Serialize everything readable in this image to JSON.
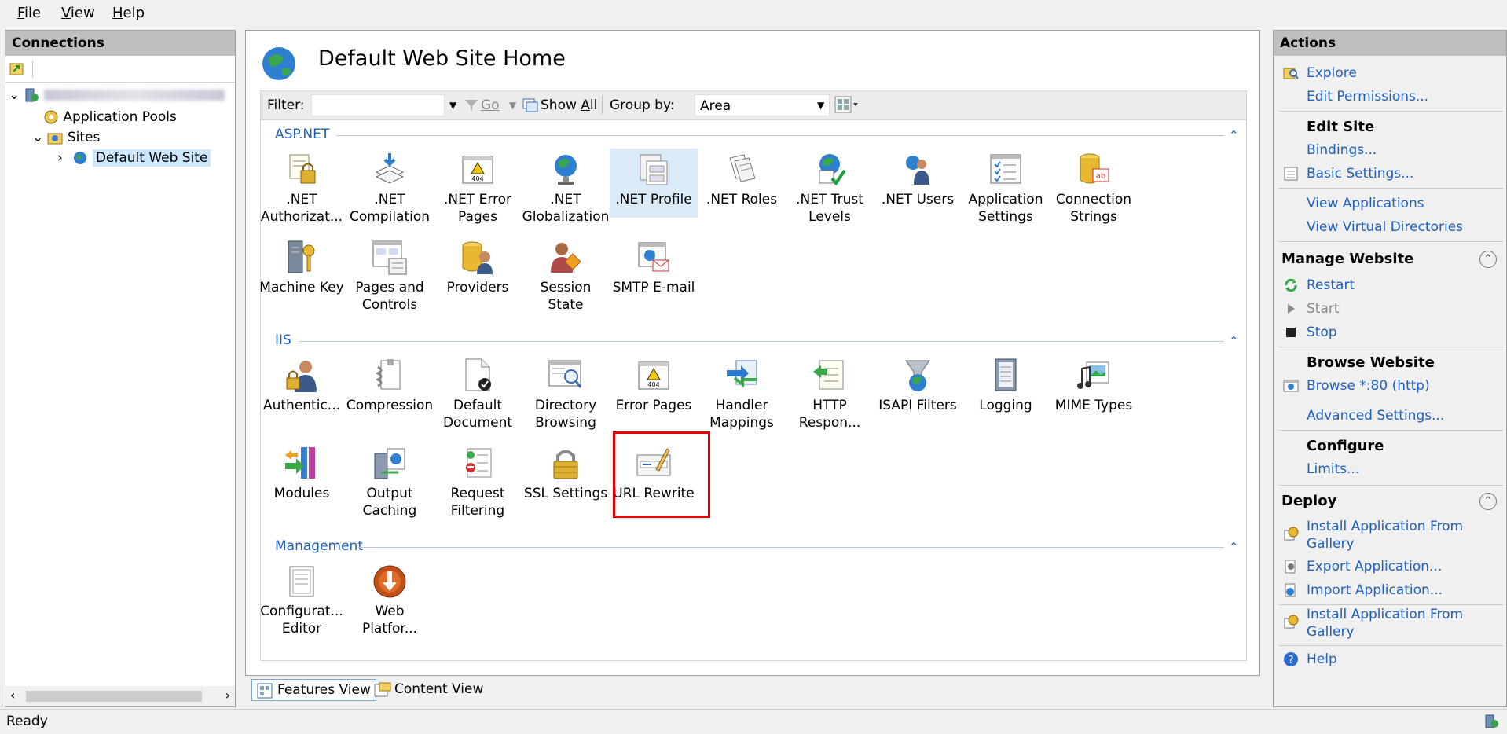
{
  "menu": {
    "file": {
      "accel": "F",
      "rest": "ile"
    },
    "view": {
      "accel": "V",
      "rest": "iew"
    },
    "help": {
      "accel": "H",
      "rest": "elp"
    }
  },
  "connections": {
    "title": "Connections",
    "tree": {
      "application_pools": "Application Pools",
      "sites": "Sites",
      "default_web_site": "Default Web Site"
    }
  },
  "center": {
    "title": "Default Web Site Home",
    "filter": {
      "label": "Filter:",
      "go": "Go",
      "show_all": {
        "pre": "Show ",
        "accel": "A",
        "rest": "ll"
      },
      "group_by_label": "Group by:",
      "group_by_value": "Area"
    },
    "groups": {
      "aspnet": {
        "title": "ASP.NET",
        "items": [
          {
            "line1": ".NET",
            "line2": "Authorizat..."
          },
          {
            "line1": ".NET",
            "line2": "Compilation"
          },
          {
            "line1": ".NET Error",
            "line2": "Pages"
          },
          {
            "line1": ".NET",
            "line2": "Globalization"
          },
          {
            "line1": ".NET Profile",
            "line2": ""
          },
          {
            "line1": ".NET Roles",
            "line2": ""
          },
          {
            "line1": ".NET Trust",
            "line2": "Levels"
          },
          {
            "line1": ".NET Users",
            "line2": ""
          },
          {
            "line1": "Application",
            "line2": "Settings"
          },
          {
            "line1": "Connection",
            "line2": "Strings"
          },
          {
            "line1": "Machine Key",
            "line2": ""
          },
          {
            "line1": "Pages and",
            "line2": "Controls"
          },
          {
            "line1": "Providers",
            "line2": ""
          },
          {
            "line1": "Session State",
            "line2": ""
          },
          {
            "line1": "SMTP E-mail",
            "line2": ""
          }
        ]
      },
      "iis": {
        "title": "IIS",
        "items": [
          {
            "line1": "Authentic...",
            "line2": ""
          },
          {
            "line1": "Compression",
            "line2": ""
          },
          {
            "line1": "Default",
            "line2": "Document"
          },
          {
            "line1": "Directory",
            "line2": "Browsing"
          },
          {
            "line1": "Error Pages",
            "line2": ""
          },
          {
            "line1": "Handler",
            "line2": "Mappings"
          },
          {
            "line1": "HTTP",
            "line2": "Respon..."
          },
          {
            "line1": "ISAPI Filters",
            "line2": ""
          },
          {
            "line1": "Logging",
            "line2": ""
          },
          {
            "line1": "MIME Types",
            "line2": ""
          },
          {
            "line1": "Modules",
            "line2": ""
          },
          {
            "line1": "Output",
            "line2": "Caching"
          },
          {
            "line1": "Request",
            "line2": "Filtering"
          },
          {
            "line1": "SSL Settings",
            "line2": ""
          },
          {
            "line1": "URL Rewrite",
            "line2": ""
          }
        ]
      },
      "management": {
        "title": "Management",
        "items": [
          {
            "line1": "Configurat...",
            "line2": "Editor"
          },
          {
            "line1": "Web",
            "line2": "Platfor..."
          }
        ]
      }
    },
    "tabs": {
      "features": "Features View",
      "content": "Content View"
    }
  },
  "actions": {
    "title": "Actions",
    "explore": "Explore",
    "edit_permissions": "Edit Permissions...",
    "edit_site": "Edit Site",
    "bindings": "Bindings...",
    "basic_settings": "Basic Settings...",
    "view_applications": "View Applications",
    "view_virtual_directories": "View Virtual Directories",
    "manage_website": "Manage Website",
    "restart": "Restart",
    "start": "Start",
    "stop": "Stop",
    "browse_website": "Browse Website",
    "browse_80": "Browse *:80 (http)",
    "advanced_settings": "Advanced Settings...",
    "configure": "Configure",
    "limits": "Limits...",
    "deploy": "Deploy",
    "install_from_gallery_1": {
      "line1": "Install Application From",
      "line2": "Gallery"
    },
    "export_application": "Export Application...",
    "import_application": "Import Application...",
    "install_from_gallery_2": {
      "line1": "Install Application From",
      "line2": "Gallery"
    },
    "help": "Help"
  },
  "status": {
    "text": "Ready"
  },
  "colors": {
    "link": "#1f5fbf",
    "selection": "#cce8ff",
    "highlight": "#e00000",
    "header": "#bfbfbf"
  }
}
